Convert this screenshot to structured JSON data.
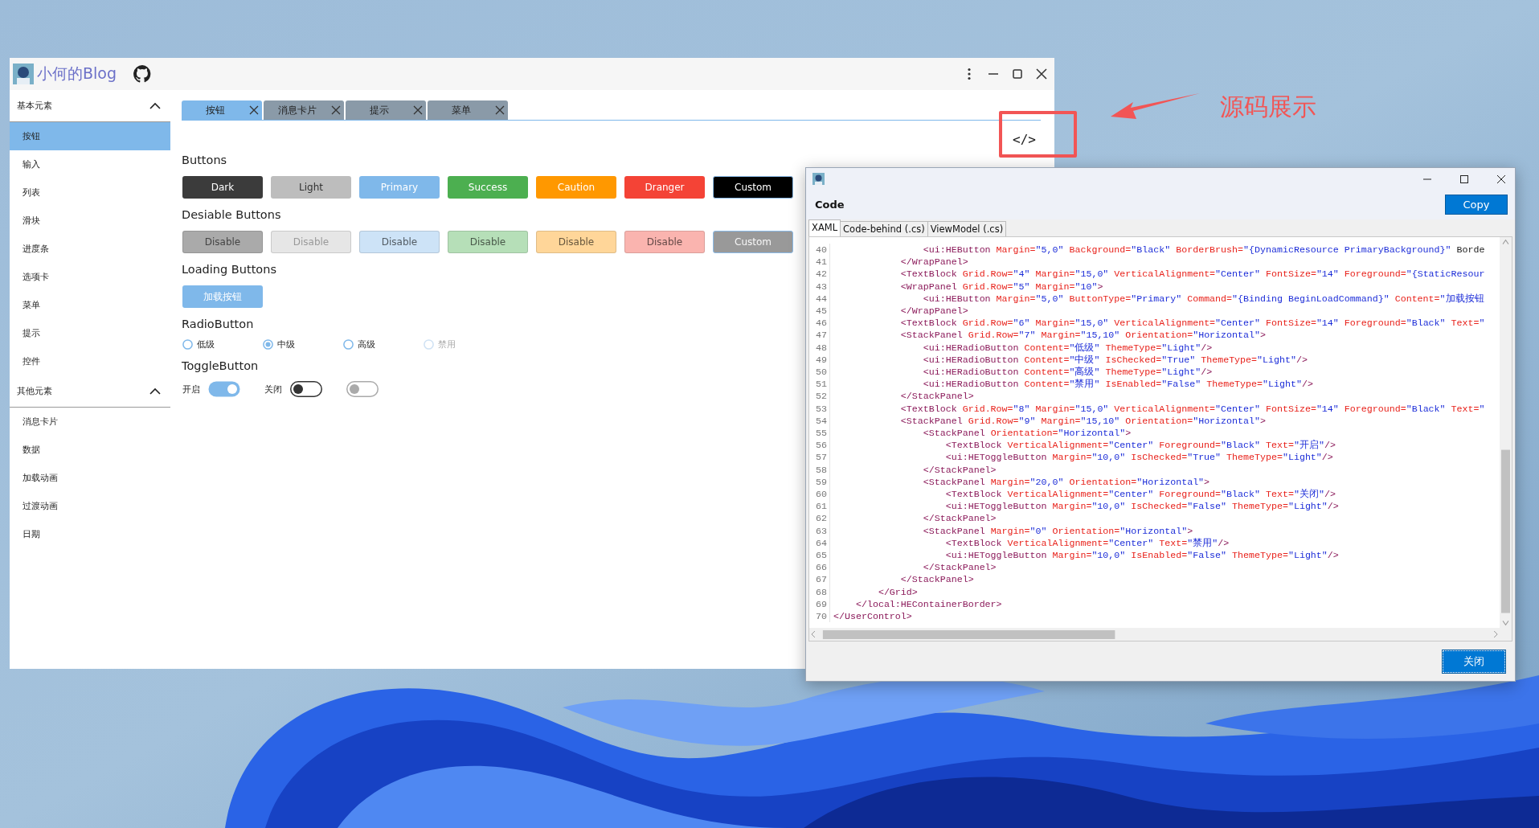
{
  "main_window": {
    "title": "小何的Blog",
    "sidebar": [
      {
        "label": "基本元素",
        "expanded": true,
        "items": [
          {
            "label": "按钮",
            "selected": true
          },
          {
            "label": "输入",
            "selected": false
          },
          {
            "label": "列表",
            "selected": false
          },
          {
            "label": "滑块",
            "selected": false
          },
          {
            "label": "进度条",
            "selected": false
          },
          {
            "label": "选项卡",
            "selected": false
          },
          {
            "label": "菜单",
            "selected": false
          },
          {
            "label": "提示",
            "selected": false
          },
          {
            "label": "控件",
            "selected": false
          }
        ]
      },
      {
        "label": "其他元素",
        "expanded": true,
        "items": [
          {
            "label": "消息卡片",
            "selected": false
          },
          {
            "label": "数据",
            "selected": false
          },
          {
            "label": "加载动画",
            "selected": false
          },
          {
            "label": "过渡动画",
            "selected": false
          },
          {
            "label": "日期",
            "selected": false
          }
        ]
      }
    ],
    "tabs": [
      {
        "label": "按钮",
        "selected": true
      },
      {
        "label": "消息卡片",
        "selected": false
      },
      {
        "label": "提示",
        "selected": false
      },
      {
        "label": "菜单",
        "selected": false
      }
    ],
    "code_button": "</>",
    "sections": [
      {
        "kind": "buttons",
        "title": "Buttons",
        "buttons": [
          {
            "label": "Dark",
            "color": "#3b3b3b",
            "disabled": false,
            "dark_label": false,
            "bordered": false
          },
          {
            "label": "Light",
            "color": "#bdbdbd",
            "disabled": false,
            "dark_label": true,
            "bordered": false
          },
          {
            "label": "Primary",
            "color": "#7fb8ea",
            "disabled": false,
            "dark_label": false,
            "bordered": false
          },
          {
            "label": "Success",
            "color": "#4caf50",
            "disabled": false,
            "dark_label": false,
            "bordered": false
          },
          {
            "label": "Caution",
            "color": "#ff9800",
            "disabled": false,
            "dark_label": false,
            "bordered": false
          },
          {
            "label": "Dranger",
            "color": "#f44336",
            "disabled": false,
            "dark_label": false,
            "bordered": false
          },
          {
            "label": "Custom",
            "color": "#000000",
            "disabled": false,
            "dark_label": false,
            "bordered": true
          }
        ]
      },
      {
        "kind": "buttons",
        "title": "Desiable Buttons",
        "buttons": [
          {
            "label": "Disable",
            "color": "#aaaaaa",
            "disabled": true,
            "dark_label": false,
            "bordered": false
          },
          {
            "label": "Disable",
            "color": "#e6e6e6",
            "disabled": true,
            "dark_label": true,
            "bordered": false
          },
          {
            "label": "Disable",
            "color": "#cde3f7",
            "disabled": true,
            "dark_label": false,
            "bordered": false
          },
          {
            "label": "Disable",
            "color": "#b6dfb8",
            "disabled": true,
            "dark_label": false,
            "bordered": false
          },
          {
            "label": "Disable",
            "color": "#ffd699",
            "disabled": true,
            "dark_label": false,
            "bordered": false
          },
          {
            "label": "Disable",
            "color": "#fab4af",
            "disabled": true,
            "dark_label": false,
            "bordered": false
          },
          {
            "label": "Custom",
            "color": "#999999",
            "disabled": true,
            "dark_label": false,
            "bordered": true
          }
        ]
      },
      {
        "kind": "buttons",
        "title": "Loading Buttons",
        "buttons": [
          {
            "label": "加载按钮",
            "color": "#7fb8ea",
            "disabled": false,
            "dark_label": false,
            "bordered": false
          }
        ]
      },
      {
        "kind": "radios",
        "title": "RadioButton",
        "items": [
          {
            "label": "低级",
            "selected": false,
            "disabled": false
          },
          {
            "label": "中级",
            "selected": true,
            "disabled": false
          },
          {
            "label": "高级",
            "selected": false,
            "disabled": false
          },
          {
            "label": "禁用",
            "selected": false,
            "disabled": true
          }
        ]
      },
      {
        "kind": "toggles",
        "title": "ToggleButton",
        "items": [
          {
            "label": "开启",
            "on": true,
            "disabled": false
          },
          {
            "label": "关闭",
            "on": false,
            "disabled": false
          },
          {
            "on": false,
            "disabled": true
          }
        ]
      }
    ]
  },
  "code_window": {
    "heading": "Code",
    "copy": "Copy",
    "tabs": [
      {
        "label": "XAML",
        "selected": true
      },
      {
        "label": "Code-behind (.cs)",
        "selected": false
      },
      {
        "label": "ViewModel (.cs)",
        "selected": false
      }
    ],
    "lines": [
      {
        "n": "40",
        "code": "                <ui:HEButton Margin=\"5,0\" Background=\"Black\" BorderBrush=\"{DynamicResource PrimaryBackground}\" Borde"
      },
      {
        "n": "41",
        "code": "            </WrapPanel>"
      },
      {
        "n": "42",
        "code": "            <TextBlock Grid.Row=\"4\" Margin=\"15,0\" VerticalAlignment=\"Center\" FontSize=\"14\" Foreground=\"{StaticResour"
      },
      {
        "n": "43",
        "code": "            <WrapPanel Grid.Row=\"5\" Margin=\"10\">"
      },
      {
        "n": "44",
        "code": "                <ui:HEButton Margin=\"5,0\" ButtonType=\"Primary\" Command=\"{Binding BeginLoadCommand}\" Content=\"加载按钮"
      },
      {
        "n": "45",
        "code": "            </WrapPanel>"
      },
      {
        "n": "46",
        "code": "            <TextBlock Grid.Row=\"6\" Margin=\"15,0\" VerticalAlignment=\"Center\" FontSize=\"14\" Foreground=\"Black\" Text=\""
      },
      {
        "n": "47",
        "code": "            <StackPanel Grid.Row=\"7\" Margin=\"15,10\" Orientation=\"Horizontal\">"
      },
      {
        "n": "48",
        "code": "                <ui:HERadioButton Content=\"低级\" ThemeType=\"Light\"/>"
      },
      {
        "n": "49",
        "code": "                <ui:HERadioButton Content=\"中级\" IsChecked=\"True\" ThemeType=\"Light\"/>"
      },
      {
        "n": "50",
        "code": "                <ui:HERadioButton Content=\"高级\" ThemeType=\"Light\"/>"
      },
      {
        "n": "51",
        "code": "                <ui:HERadioButton Content=\"禁用\" IsEnabled=\"False\" ThemeType=\"Light\"/>"
      },
      {
        "n": "52",
        "code": "            </StackPanel>"
      },
      {
        "n": "53",
        "code": "            <TextBlock Grid.Row=\"8\" Margin=\"15,0\" VerticalAlignment=\"Center\" FontSize=\"14\" Foreground=\"Black\" Text=\""
      },
      {
        "n": "54",
        "code": "            <StackPanel Grid.Row=\"9\" Margin=\"15,10\" Orientation=\"Horizontal\">"
      },
      {
        "n": "55",
        "code": "                <StackPanel Orientation=\"Horizontal\">"
      },
      {
        "n": "56",
        "code": "                    <TextBlock VerticalAlignment=\"Center\" Foreground=\"Black\" Text=\"开启\"/>"
      },
      {
        "n": "57",
        "code": "                    <ui:HEToggleButton Margin=\"10,0\" IsChecked=\"True\" ThemeType=\"Light\"/>"
      },
      {
        "n": "58",
        "code": "                </StackPanel>"
      },
      {
        "n": "59",
        "code": "                <StackPanel Margin=\"20,0\" Orientation=\"Horizontal\">"
      },
      {
        "n": "60",
        "code": "                    <TextBlock VerticalAlignment=\"Center\" Foreground=\"Black\" Text=\"关闭\"/>"
      },
      {
        "n": "61",
        "code": "                    <ui:HEToggleButton Margin=\"10,0\" IsChecked=\"False\" ThemeType=\"Light\"/>"
      },
      {
        "n": "62",
        "code": "                </StackPanel>"
      },
      {
        "n": "63",
        "code": "                <StackPanel Margin=\"0\" Orientation=\"Horizontal\">"
      },
      {
        "n": "64",
        "code": "                    <TextBlock VerticalAlignment=\"Center\" Text=\"禁用\"/>"
      },
      {
        "n": "65",
        "code": "                    <ui:HEToggleButton Margin=\"10,0\" IsEnabled=\"False\" ThemeType=\"Light\"/>"
      },
      {
        "n": "66",
        "code": "                </StackPanel>"
      },
      {
        "n": "67",
        "code": "            </StackPanel>"
      },
      {
        "n": "68",
        "code": "        </Grid>"
      },
      {
        "n": "69",
        "code": "    </local:HEContainerBorder>"
      },
      {
        "n": "70",
        "code": "</UserControl>"
      }
    ],
    "close": "关闭"
  },
  "annotation": {
    "label": "源码展示"
  }
}
